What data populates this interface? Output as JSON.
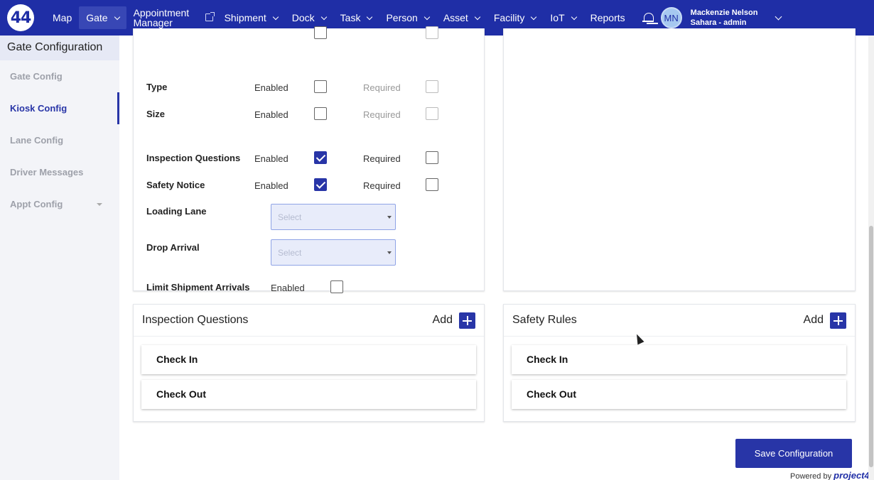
{
  "nav": {
    "logo": "44",
    "items": [
      {
        "label": "Map"
      },
      {
        "label": "Gate"
      },
      {
        "label_line1": "Appointment",
        "label_line2": "Manager"
      },
      {
        "label": "Shipment"
      },
      {
        "label": "Dock"
      },
      {
        "label": "Task"
      },
      {
        "label": "Person"
      },
      {
        "label": "Asset"
      },
      {
        "label": "Facility"
      },
      {
        "label": "IoT"
      },
      {
        "label": "Reports"
      }
    ],
    "avatar_initials": "MN",
    "user_name": "Mackenzie Nelson",
    "user_role": "Sahara - admin"
  },
  "sidebar": {
    "title": "Gate Configuration",
    "items": [
      {
        "label": "Gate Config"
      },
      {
        "label": "Kiosk Config"
      },
      {
        "label": "Lane Config"
      },
      {
        "label": "Driver Messages"
      },
      {
        "label": "Appt Config"
      }
    ]
  },
  "form": {
    "enabled_label": "Enabled",
    "required_label": "Required",
    "rows": [
      {
        "label": "Type",
        "enabled": false,
        "required": false
      },
      {
        "label": "Size",
        "enabled": false,
        "required": false
      },
      {
        "label": "Inspection Questions",
        "enabled": true,
        "required": false
      },
      {
        "label": "Safety Notice",
        "enabled": true,
        "required": false
      }
    ],
    "loading_lane": {
      "label": "Loading Lane",
      "placeholder": "Select"
    },
    "drop_arrival": {
      "label": "Drop Arrival",
      "placeholder": "Select"
    },
    "limit_shipment": {
      "label": "Limit Shipment Arrivals",
      "enabled_label": "Enabled",
      "enabled": false
    }
  },
  "inspection": {
    "title": "Inspection Questions",
    "add_label": "Add",
    "items": [
      "Check In",
      "Check Out"
    ]
  },
  "safety": {
    "title": "Safety Rules",
    "add_label": "Add",
    "items": [
      "Check In",
      "Check Out"
    ]
  },
  "save_label": "Save Configuration",
  "powered_label": "Powered by",
  "powered_brand": "project44",
  "colors": {
    "primary": "#1f2ea6",
    "accent": "#2835a7"
  }
}
